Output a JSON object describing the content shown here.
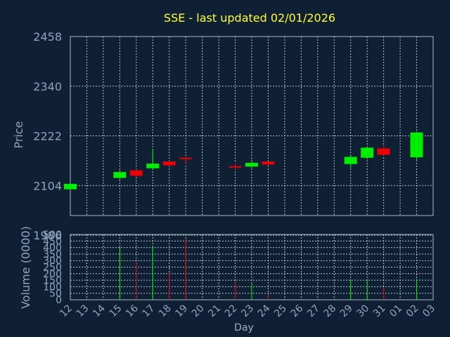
{
  "chart_data": {
    "type": "candlestick",
    "title": "SSE - last updated 02/01/2026",
    "ylabel_price": "Price",
    "ylabel_volume": "Volume (0000)",
    "xlabel": "Day",
    "price_ylim": [
      1986,
      2458
    ],
    "price_ticks": [
      2458,
      2340,
      2222,
      2104,
      1986
    ],
    "volume_ylim": [
      0,
      500
    ],
    "volume_ticks": [
      500,
      450,
      400,
      350,
      300,
      250,
      200,
      150,
      100,
      50,
      0
    ],
    "grid": true,
    "days": [
      "12",
      "13",
      "14",
      "15",
      "16",
      "17",
      "18",
      "19",
      "20",
      "21",
      "22",
      "23",
      "24",
      "25",
      "26",
      "27",
      "28",
      "29",
      "30",
      "31",
      "01",
      "02",
      "03"
    ],
    "candles": [
      {
        "day": "12",
        "open": 2095,
        "high": 2110,
        "low": 2092,
        "close": 2108
      },
      {
        "day": "15",
        "open": 2122,
        "high": 2140,
        "low": 2118,
        "close": 2136
      },
      {
        "day": "16",
        "open": 2140,
        "high": 2143,
        "low": 2125,
        "close": 2127
      },
      {
        "day": "17",
        "open": 2145,
        "high": 2190,
        "low": 2141,
        "close": 2156
      },
      {
        "day": "18",
        "open": 2161,
        "high": 2164,
        "low": 2150,
        "close": 2152
      },
      {
        "day": "19",
        "open": 2170,
        "high": 2172,
        "low": 2154,
        "close": 2168
      },
      {
        "day": "22",
        "open": 2150,
        "high": 2158,
        "low": 2140,
        "close": 2148
      },
      {
        "day": "23",
        "open": 2149,
        "high": 2166,
        "low": 2143,
        "close": 2158
      },
      {
        "day": "24",
        "open": 2161,
        "high": 2162,
        "low": 2151,
        "close": 2154
      },
      {
        "day": "29",
        "open": 2155,
        "high": 2177,
        "low": 2146,
        "close": 2172
      },
      {
        "day": "30",
        "open": 2170,
        "high": 2195,
        "low": 2166,
        "close": 2194
      },
      {
        "day": "31",
        "open": 2192,
        "high": 2199,
        "low": 2175,
        "close": 2177
      },
      {
        "day": "02",
        "open": 2171,
        "high": 2232,
        "low": 2163,
        "close": 2230
      }
    ],
    "volume": [
      {
        "day": "15",
        "value": 400,
        "color": "up"
      },
      {
        "day": "16",
        "value": 290,
        "color": "down"
      },
      {
        "day": "17",
        "value": 410,
        "color": "up"
      },
      {
        "day": "18",
        "value": 210,
        "color": "down"
      },
      {
        "day": "19",
        "value": 470,
        "color": "down"
      },
      {
        "day": "22",
        "value": 130,
        "color": "down"
      },
      {
        "day": "23",
        "value": 130,
        "color": "up"
      },
      {
        "day": "24",
        "value": 40,
        "color": "down"
      },
      {
        "day": "29",
        "value": 150,
        "color": "up"
      },
      {
        "day": "30",
        "value": 150,
        "color": "up"
      },
      {
        "day": "31",
        "value": 90,
        "color": "down"
      },
      {
        "day": "02",
        "value": 160,
        "color": "up"
      }
    ],
    "colors": {
      "up": "#00ee00",
      "down": "#ee0000",
      "background": "#0f2035"
    }
  }
}
